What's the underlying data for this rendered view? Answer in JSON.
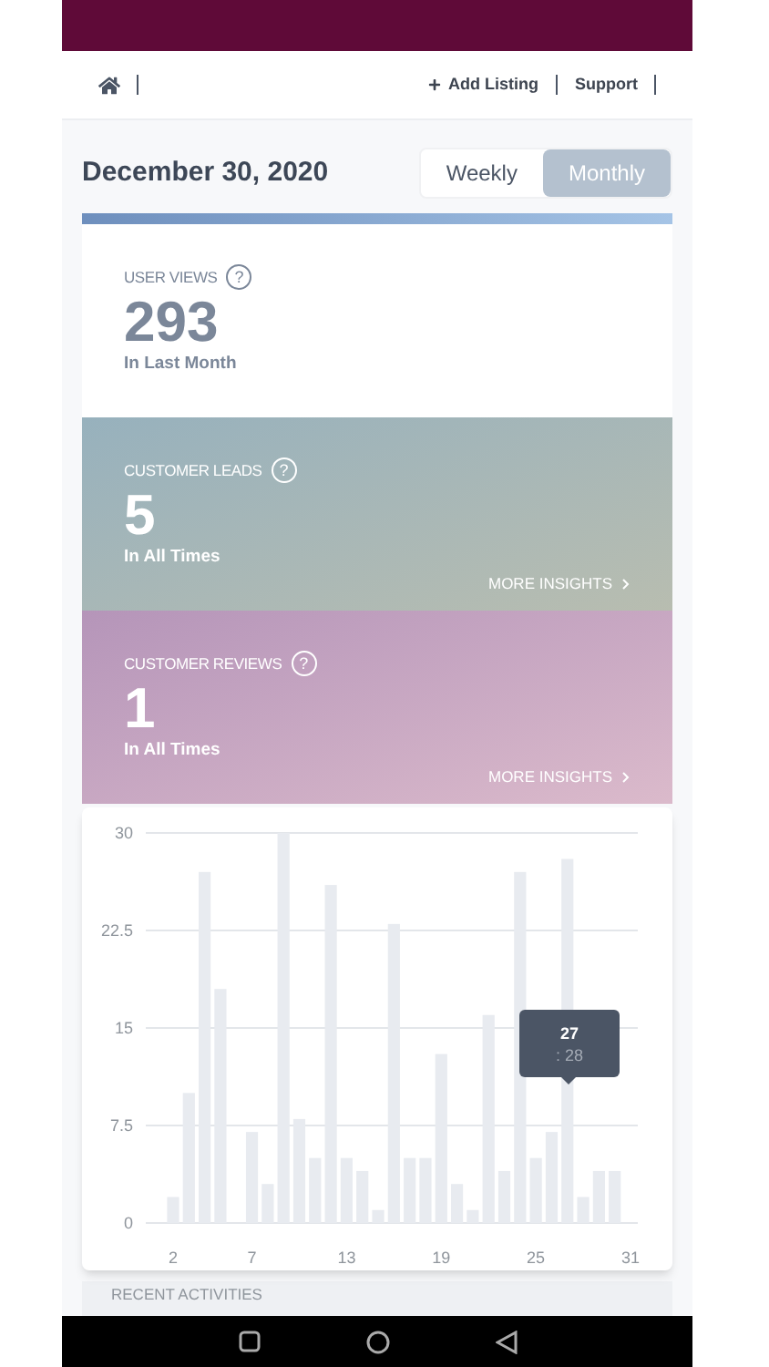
{
  "header": {
    "links": [
      {
        "label": "Add Listing"
      },
      {
        "label": "Support"
      }
    ]
  },
  "date": "December 30, 2020",
  "period_tabs": [
    {
      "label": "Weekly",
      "selected": false
    },
    {
      "label": "Monthly",
      "selected": true
    }
  ],
  "stats": [
    {
      "kind": "plain",
      "title": "USER VIEWS",
      "value": "293",
      "caption": "In Last Month",
      "help": "?"
    },
    {
      "kind": "teal",
      "title": "CUSTOMER LEADS",
      "help": "?",
      "value": "5",
      "caption": "In All Times",
      "link": "MORE INSIGHTS"
    },
    {
      "kind": "purple",
      "title": "CUSTOMER REVIEWS",
      "help": "?",
      "value": "1",
      "caption": "In All Times",
      "link": "MORE INSIGHTS"
    }
  ],
  "chart": {
    "chart_data": {
      "type": "bar",
      "x": [
        2,
        3,
        4,
        5,
        6,
        7,
        8,
        9,
        10,
        11,
        12,
        13,
        14,
        15,
        16,
        17,
        18,
        19,
        20,
        21,
        22,
        23,
        24,
        25,
        26,
        27,
        28,
        29,
        30,
        31
      ],
      "series": [
        {
          "color": "#e8ebf0",
          "values": [
            2,
            10,
            27,
            18,
            0,
            7,
            3,
            30,
            8,
            5,
            26,
            5,
            4,
            1,
            23,
            5,
            5,
            13,
            3,
            1,
            16,
            4,
            27,
            5,
            7,
            28,
            2,
            4,
            4,
            0
          ]
        }
      ],
      "xlim": [
        2,
        31
      ],
      "ylim": [
        0,
        30
      ],
      "yticks": [
        0,
        7.5,
        15,
        22.5,
        30
      ],
      "xticks": [
        2,
        7,
        13,
        19,
        25,
        31
      ],
      "grid": true
    },
    "tooltip": {
      "title": "27",
      "value": ": 28"
    }
  },
  "recent_title": "RECENT ACTIVITIES"
}
